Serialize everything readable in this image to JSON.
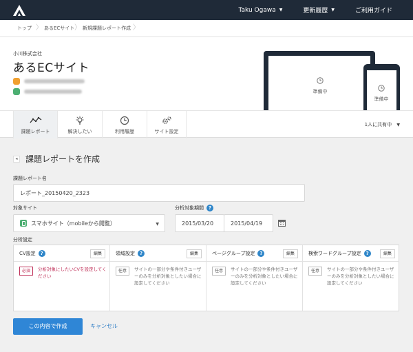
{
  "topbar": {
    "user": "Taku Ogawa",
    "updates": "更新履歴",
    "guide": "ご利用ガイド"
  },
  "breadcrumb": [
    "トップ",
    "あるECサイト",
    "新規課題レポート作成"
  ],
  "header": {
    "company": "小川株式会社",
    "site_name": "あるECサイト",
    "preview_status_laptop": "準備中",
    "preview_status_phone": "準備中"
  },
  "tabs": [
    {
      "label": "課題レポート",
      "icon": "trend-chart-icon"
    },
    {
      "label": "解決したい",
      "icon": "lightbulb-icon"
    },
    {
      "label": "利用履歴",
      "icon": "clock-icon"
    },
    {
      "label": "サイト設定",
      "icon": "gears-icon"
    }
  ],
  "share": "1人に共有中",
  "form": {
    "section_title": "課題レポートを作成",
    "name_label": "課題レポート名",
    "name_value": "レポート_20150420_2323",
    "site_label": "対象サイト",
    "site_value": "スマホサイト（mobileから閲覧）",
    "period_label": "分析対象期間",
    "date_from": "2015/03/20",
    "date_to": "2015/04/19",
    "settings_label": "分析設定",
    "settings": [
      {
        "title": "CV設定",
        "edit": "編集",
        "tag": "必須",
        "desc": "分析対象にしたいCVを設定してください"
      },
      {
        "title": "領域設定",
        "edit": "編集",
        "tag": "任意",
        "desc": "サイトの一部分や条件付きユーザーのみを分析対象としたい場合に設定してください"
      },
      {
        "title": "ページグループ設定",
        "edit": "編集",
        "tag": "任意",
        "desc": "サイトの一部分や条件付きユーザーのみを分析対象としたい場合に設定してください"
      },
      {
        "title": "検索ワードグループ設定",
        "edit": "編集",
        "tag": "任意",
        "desc": "サイトの一部分や条件付きユーザーのみを分析対象としたい場合に設定してください"
      }
    ],
    "submit": "この内容で作成",
    "cancel": "キャンセル"
  },
  "colors": {
    "topbar": "#1f2a38",
    "primary": "#2f86d6",
    "required": "#c0325a",
    "help": "#2f86c9"
  }
}
